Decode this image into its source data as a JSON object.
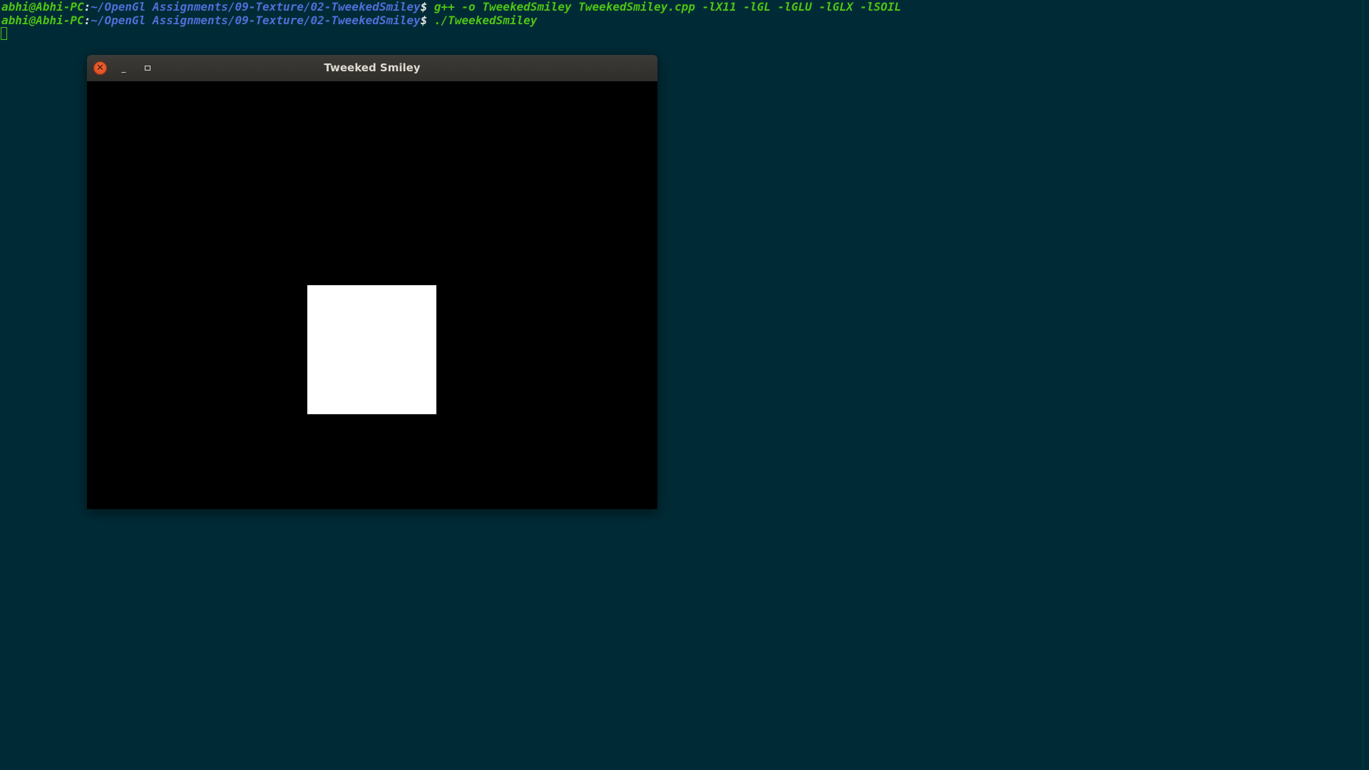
{
  "terminal": {
    "lines": [
      {
        "user_host": "abhi@Abhi-PC",
        "colon": ":",
        "path": "~/OpenGl Assignments/09-Texture/02-TweekedSmiley",
        "prompt_sign": "$",
        "command": " g++ -o TweekedSmiley TweekedSmiley.cpp -lX11 -lGL -lGLU -lGLX -lSOIL"
      },
      {
        "user_host": "abhi@Abhi-PC",
        "colon": ":",
        "path": "~/OpenGl Assignments/09-Texture/02-TweekedSmiley",
        "prompt_sign": "$",
        "command": " ./TweekedSmiley"
      }
    ],
    "colors": {
      "background": "#002b36",
      "user_host": "#4fc414",
      "path": "#4f6fd8",
      "command": "#4fc414"
    }
  },
  "window": {
    "title": "Tweeked Smiley",
    "close_icon": "close-icon",
    "minimize_icon": "minimize-icon",
    "maximize_icon": "maximize-icon",
    "close_glyph": "✕",
    "minimize_glyph": "_",
    "canvas_background": "#000000",
    "quad_color": "#ffffff"
  }
}
